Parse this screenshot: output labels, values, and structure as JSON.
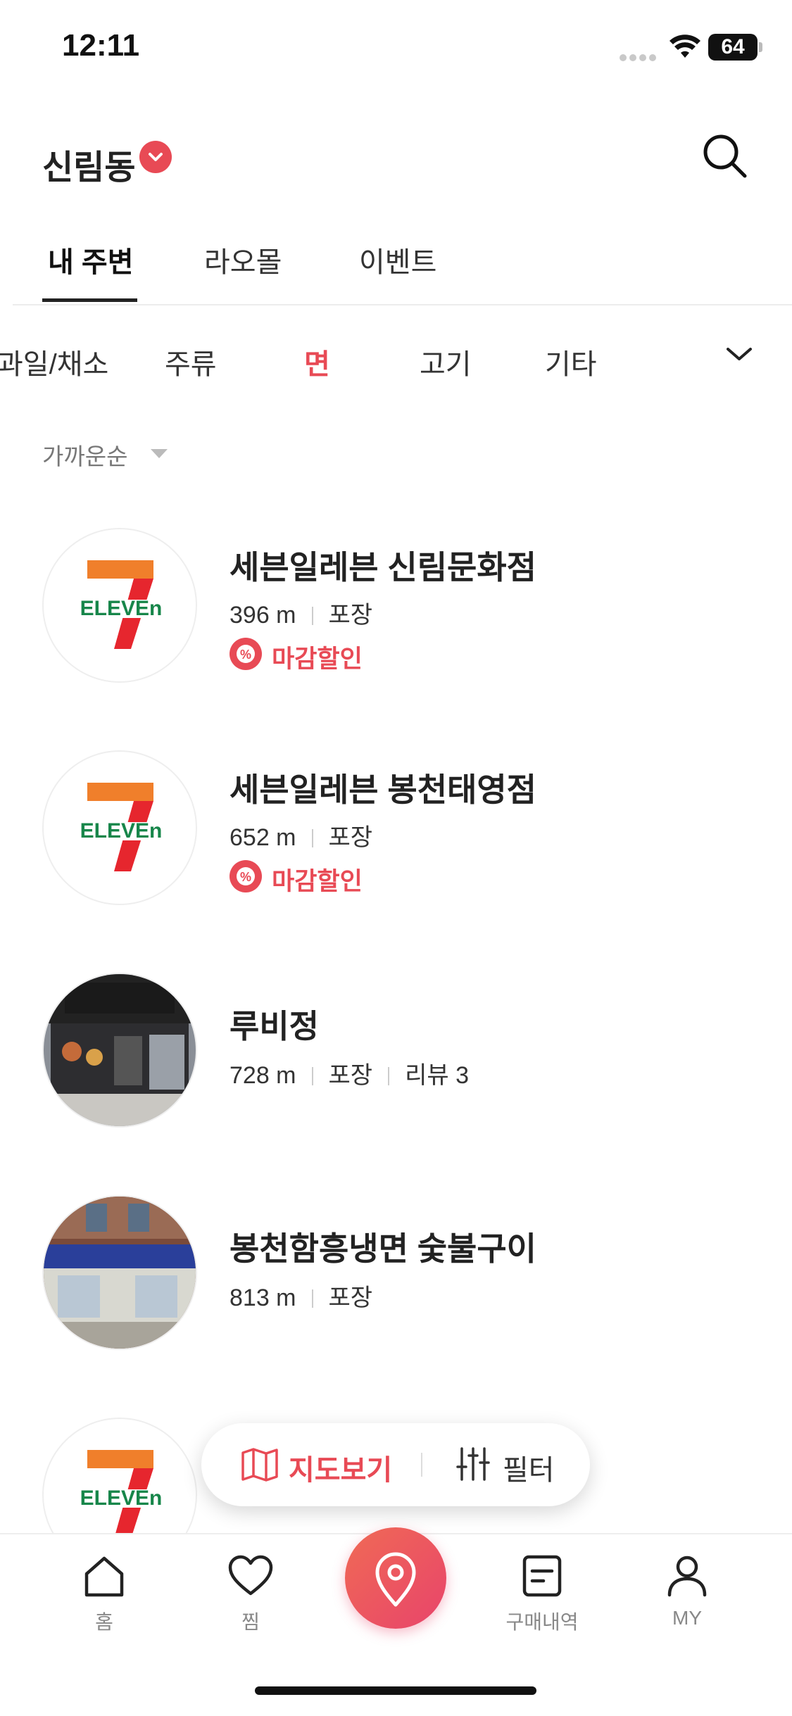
{
  "status_bar": {
    "time": "12:11",
    "battery": "64"
  },
  "header": {
    "location": "신림동"
  },
  "tabs": [
    {
      "label": "내 주변",
      "active": true
    },
    {
      "label": "라오몰",
      "active": false
    },
    {
      "label": "이벤트",
      "active": false
    }
  ],
  "categories": [
    {
      "label": "과일/채소",
      "active": false
    },
    {
      "label": "주류",
      "active": false
    },
    {
      "label": "면",
      "active": true
    },
    {
      "label": "고기",
      "active": false
    },
    {
      "label": "기타",
      "active": false
    }
  ],
  "sort": {
    "label": "가까운순"
  },
  "stores": [
    {
      "name": "세븐일레븐 신림문화점",
      "distance": "396 m",
      "type": "포장",
      "review": "",
      "badge": "마감할인",
      "image": "seven-eleven-logo"
    },
    {
      "name": "세븐일레븐 봉천태영점",
      "distance": "652 m",
      "type": "포장",
      "review": "",
      "badge": "마감할인",
      "image": "seven-eleven-logo"
    },
    {
      "name": "루비정",
      "distance": "728 m",
      "type": "포장",
      "review": "리뷰 3",
      "badge": "",
      "image": "storefront-photo"
    },
    {
      "name": "봉천함흥냉면 숯불구이",
      "distance": "813 m",
      "type": "포장",
      "review": "",
      "badge": "",
      "image": "storefront-photo"
    },
    {
      "name": "",
      "distance": "",
      "type": "",
      "review": "",
      "badge": "",
      "image": "seven-eleven-logo"
    }
  ],
  "floating": {
    "map_label": "지도보기",
    "filter_label": "필터"
  },
  "bottom_nav": [
    {
      "label": "홈",
      "icon": "home-icon"
    },
    {
      "label": "찜",
      "icon": "heart-icon"
    },
    {
      "label": "",
      "icon": "location-pin-icon"
    },
    {
      "label": "구매내역",
      "icon": "receipt-icon"
    },
    {
      "label": "MY",
      "icon": "user-icon"
    }
  ],
  "colors": {
    "accent": "#e84a55",
    "text": "#222222",
    "muted": "#888888"
  }
}
